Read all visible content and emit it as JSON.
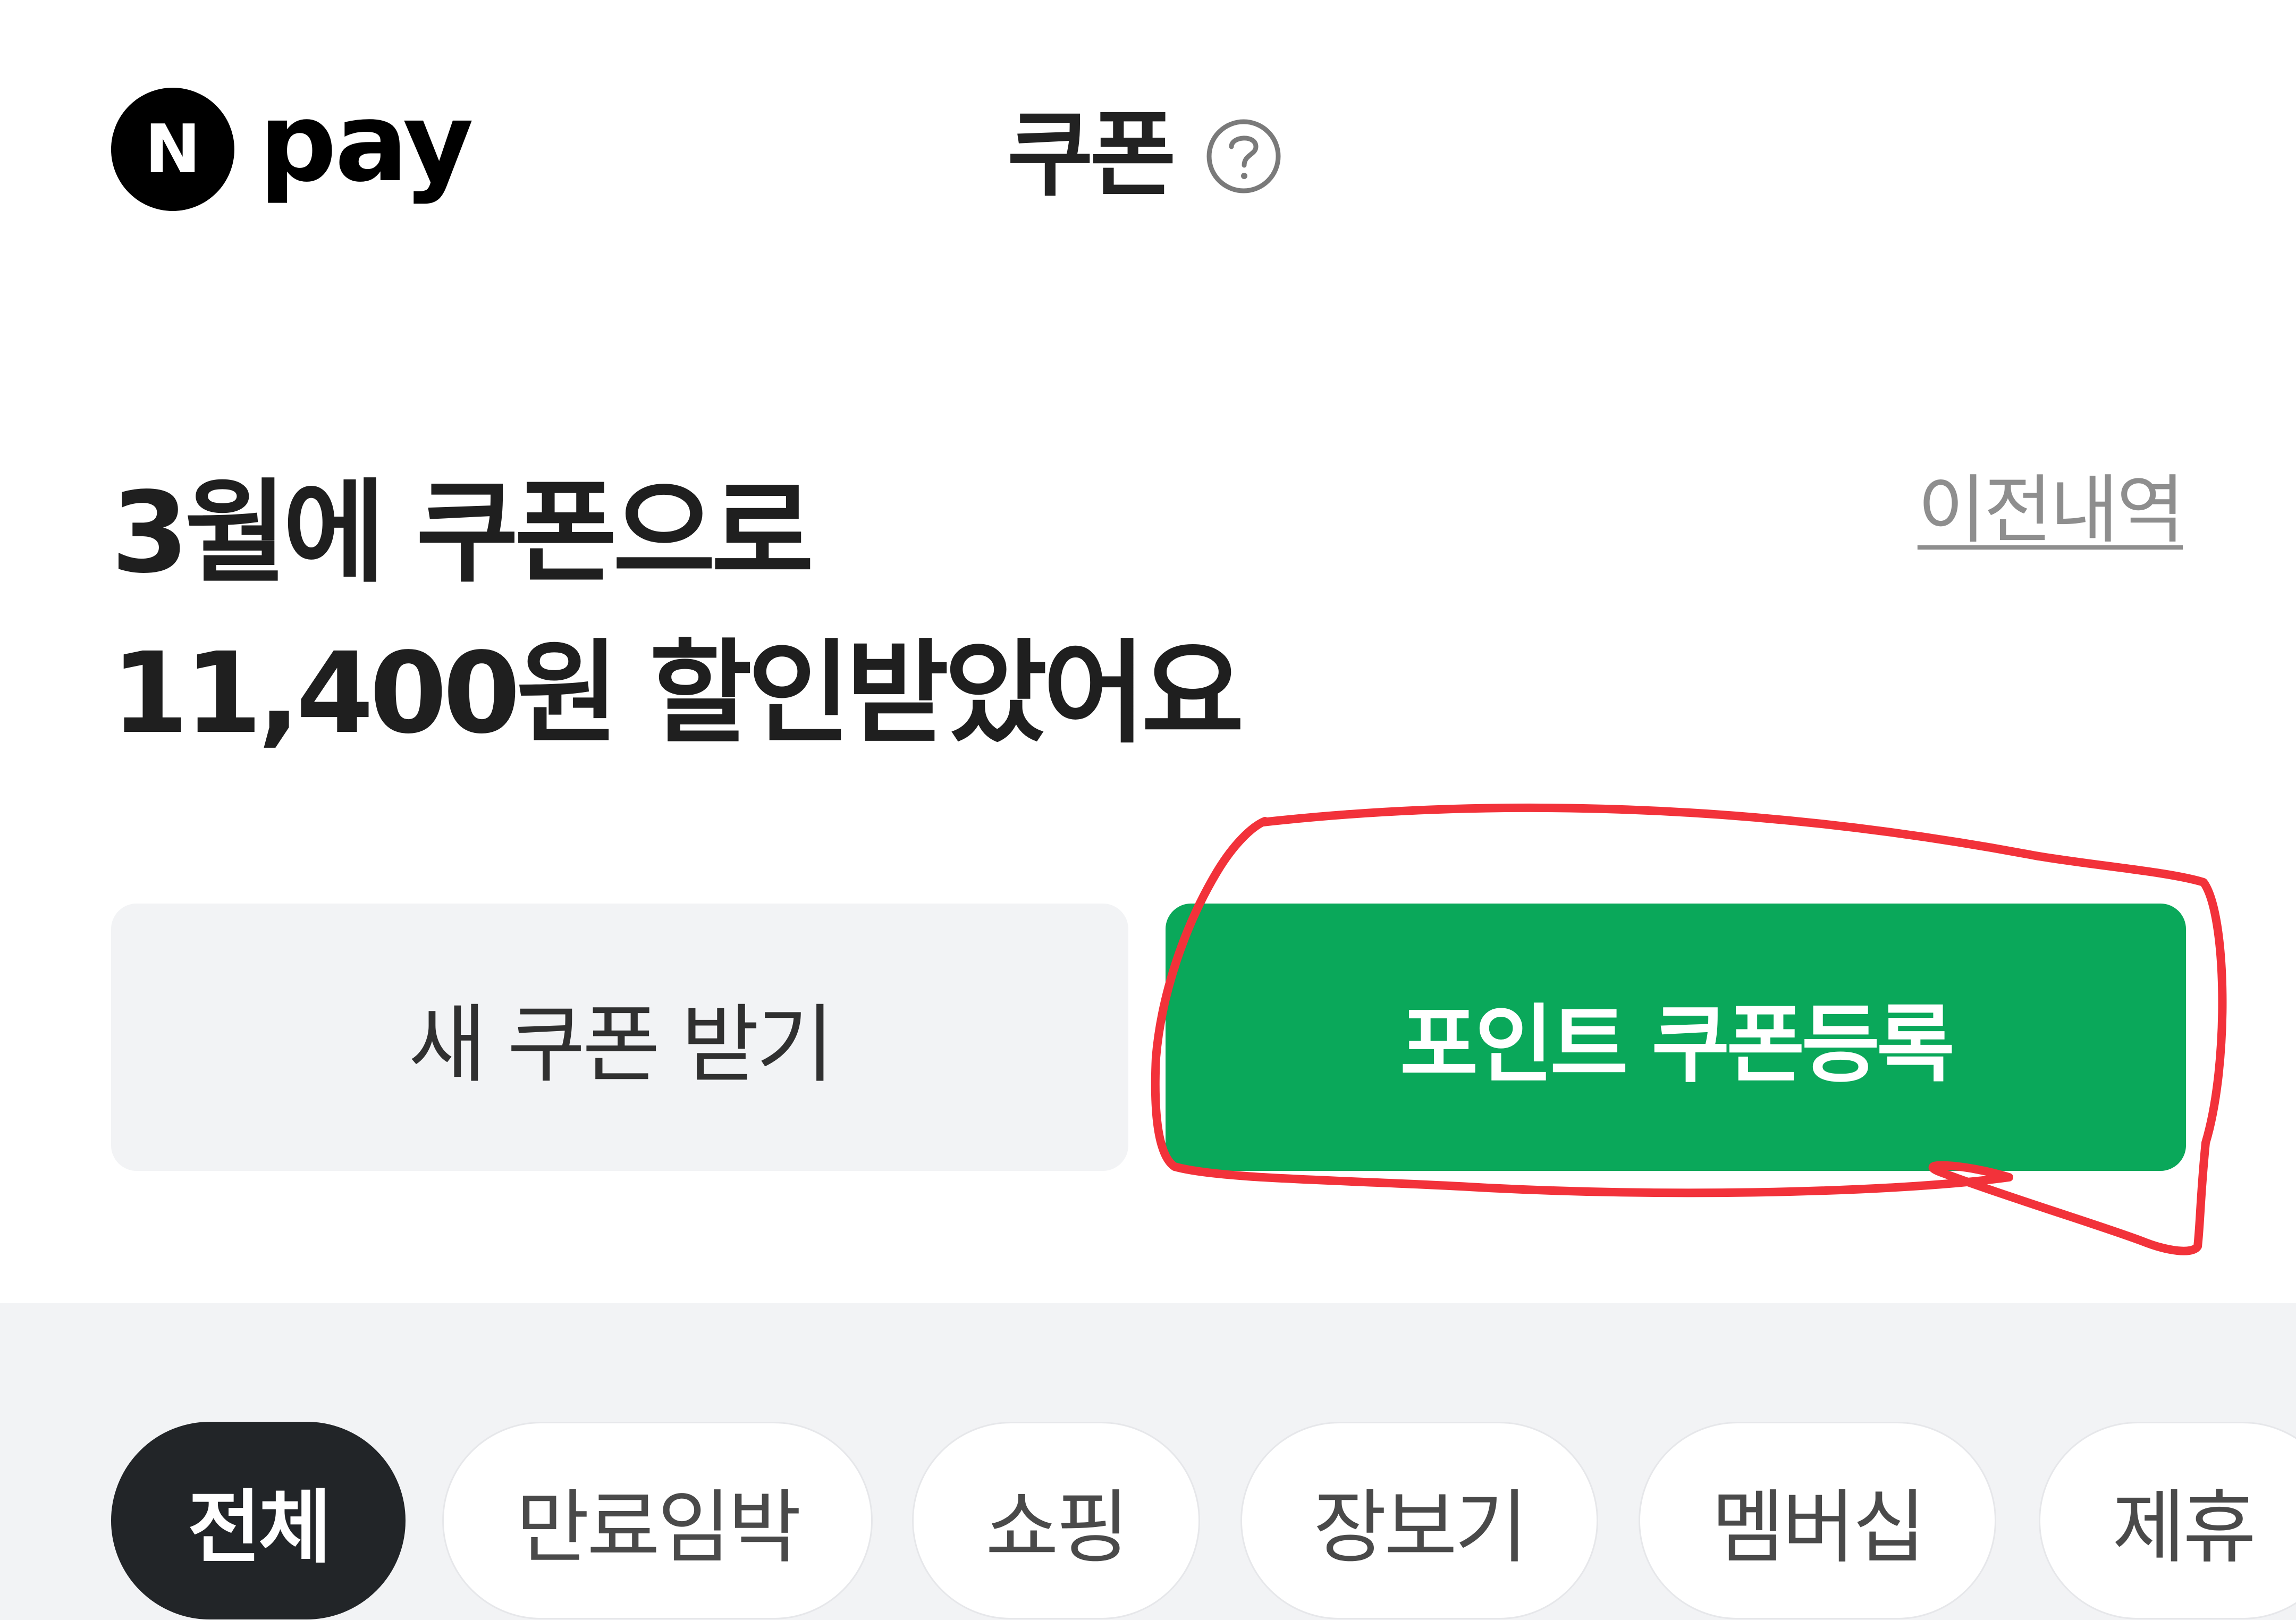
{
  "header": {
    "logo_mark": "N",
    "logo_text": "pay",
    "title": "쿠폰",
    "help_icon": "question-circle-icon"
  },
  "summary": {
    "line1": "3월에 쿠폰으로",
    "line2": "11,400원 할인받았어요",
    "history_link": "이전내역"
  },
  "actions": {
    "new_coupon": "새 쿠폰 받기",
    "register_coupon": "포인트 쿠폰등록"
  },
  "categories": [
    {
      "label": "전체",
      "active": true
    },
    {
      "label": "만료임박",
      "active": false
    },
    {
      "label": "쇼핑",
      "active": false
    },
    {
      "label": "장보기",
      "active": false
    },
    {
      "label": "멤버십",
      "active": false
    },
    {
      "label": "제휴",
      "active": false
    }
  ],
  "colors": {
    "primary_green": "#0aa85a",
    "annotation_red": "#f2323a",
    "active_chip": "#222528"
  }
}
